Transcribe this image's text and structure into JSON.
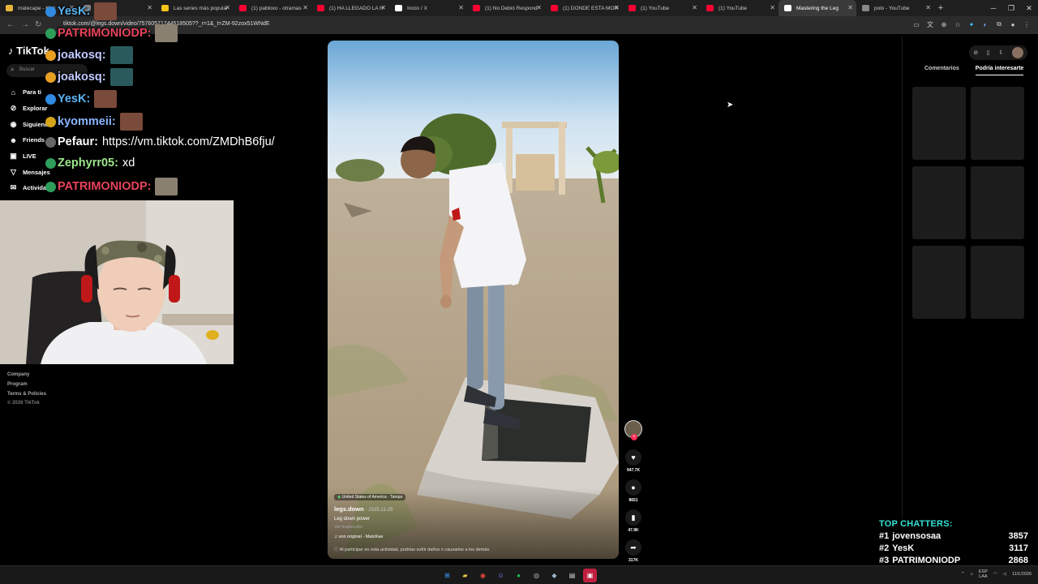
{
  "browser": {
    "tabs": [
      {
        "title": "matecape - Kick",
        "color": "#e7b53c"
      },
      {
        "title": "",
        "color": "#888888"
      },
      {
        "title": "Las series más popular",
        "color": "#f5c518"
      },
      {
        "title": "(1) pabloxo - otramas",
        "color": "#ff0033"
      },
      {
        "title": "(1) HA LLEGADO LA H",
        "color": "#ff0033"
      },
      {
        "title": "Inicio / X",
        "color": "#ffffff"
      },
      {
        "title": "(1) No Debió Respond",
        "color": "#ff0033"
      },
      {
        "title": "(1) DONDE ESTA MOR",
        "color": "#ff0033"
      },
      {
        "title": "(1) YouTube",
        "color": "#ff0033"
      },
      {
        "title": "(1) YouTube",
        "color": "#ff0033"
      },
      {
        "title": "Mastering the Leg",
        "color": "#ffffff"
      },
      {
        "title": "polo - YouTube",
        "color": "#888888"
      }
    ],
    "url": "tiktok.com/@legs.down/video/75760571744518505??_r=1&_t=ZM-92zox51WNdE"
  },
  "tiktok": {
    "logo": "TikTok",
    "search_placeholder": "Buscar",
    "nav": [
      {
        "label": "Para ti",
        "icon": "home-icon",
        "glyph": "⌂"
      },
      {
        "label": "Explorar",
        "icon": "compass-icon",
        "glyph": "⊘"
      },
      {
        "label": "Siguiendo",
        "icon": "following-icon",
        "glyph": "◉"
      },
      {
        "label": "Friends",
        "icon": "friends-icon",
        "glyph": "☻"
      },
      {
        "label": "LIVE",
        "icon": "live-icon",
        "glyph": "▣"
      },
      {
        "label": "Mensajes",
        "icon": "messages-icon",
        "glyph": "▽"
      },
      {
        "label": "Actividad",
        "icon": "activity-icon",
        "glyph": "✉"
      }
    ],
    "footer": {
      "company": "Company",
      "program": "Program",
      "terms": "Terms & Policies",
      "copyright": "© 2026 TikTok"
    }
  },
  "chat": [
    {
      "user": "YesK:",
      "text": "",
      "color": "#5ab4f5"
    },
    {
      "user": "PATRIMONIODP:",
      "text": "",
      "color": "#e8425a"
    },
    {
      "user": "joakosq:",
      "text": "",
      "color": "#bfc9ff"
    },
    {
      "user": "joakosq:",
      "text": "",
      "color": "#bfc9ff"
    },
    {
      "user": "YesK:",
      "text": "",
      "color": "#5ab4f5"
    },
    {
      "user": "kyommeii:",
      "text": "",
      "color": "#8ab4ff"
    },
    {
      "user": "Pefaur:",
      "text": "https://vm.tiktok.com/ZMDhB6fju/",
      "color": "#ffffff"
    },
    {
      "user": "Zephyrr05:",
      "text": "xd",
      "color": "#9ee68c"
    },
    {
      "user": "PATRIMONIODP:",
      "text": "",
      "color": "#e8425a"
    }
  ],
  "video": {
    "location": "United States of America · Tampa",
    "author": "legs.down",
    "date": "· 2025-11-25",
    "description": "Leg down power",
    "translation": "Ver traducción",
    "sound": "son original - MatzKae",
    "warning": "Al participar en esta actividad, podrías sufrir daños o causarlos a los demás."
  },
  "actions": {
    "likes": "947.7K",
    "comments": "8651",
    "saves": "47.9K",
    "shares": "317K"
  },
  "right_panel": {
    "tab_comments": "Comentarios",
    "tab_suggested": "Podría interesarte"
  },
  "top_chatters": {
    "title": "TOP CHATTERS:",
    "rows": [
      {
        "rank": "#1",
        "name": "jovensosaa",
        "count": "3857"
      },
      {
        "rank": "#2",
        "name": "YesK",
        "count": "3117"
      },
      {
        "rank": "#3",
        "name": "PATRIMONIODP",
        "count": "2868"
      }
    ]
  },
  "taskbar": {
    "lang": "ESP",
    "region": "LAA",
    "date": "11/1/2026"
  }
}
